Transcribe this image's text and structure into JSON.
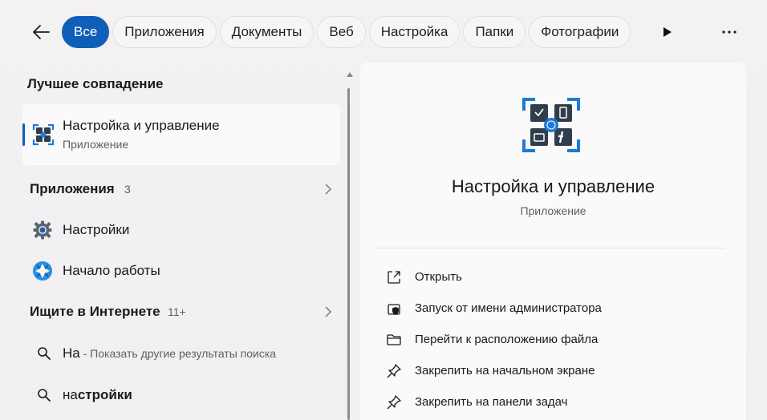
{
  "filter_bar": {
    "back_icon": "arrow-left-icon",
    "chips": [
      "Все",
      "Приложения",
      "Документы",
      "Веб",
      "Настройка",
      "Папки",
      "Фотографии"
    ],
    "active_chip": "Все",
    "play_icon": "play-icon",
    "more_icon": "more-icon",
    "accent_color": "#0f5fb8"
  },
  "results": {
    "best_match_header": "Лучшее совпадение",
    "best_match": {
      "title": "Настройка и управление",
      "subtitle": "Приложение",
      "icon": "ecm-app-icon"
    },
    "apps_group": {
      "label": "Приложения",
      "count": "3"
    },
    "apps": [
      {
        "label": "Настройки",
        "icon": "settings-gear-icon"
      },
      {
        "label": "Начало работы",
        "icon": "get-started-icon"
      }
    ],
    "web_group": {
      "label": "Ищите в Интернете",
      "count": "11+"
    },
    "web_results": [
      {
        "query": "На",
        "suffix": " - Показать другие результаты поиска"
      },
      {
        "query_plain": "на",
        "query_bold": "стройки"
      }
    ]
  },
  "detail": {
    "title": "Настройка и управление",
    "subtitle": "Приложение",
    "icon": "ecm-app-icon",
    "actions": [
      {
        "label": "Открыть",
        "icon": "open-external-icon"
      },
      {
        "label": "Запуск от имени администратора",
        "icon": "admin-shield-icon"
      },
      {
        "label": "Перейти к расположению файла",
        "icon": "folder-icon"
      },
      {
        "label": "Закрепить на начальном экране",
        "icon": "pin-icon"
      },
      {
        "label": "Закрепить на панели задач",
        "icon": "pin-icon"
      }
    ]
  }
}
